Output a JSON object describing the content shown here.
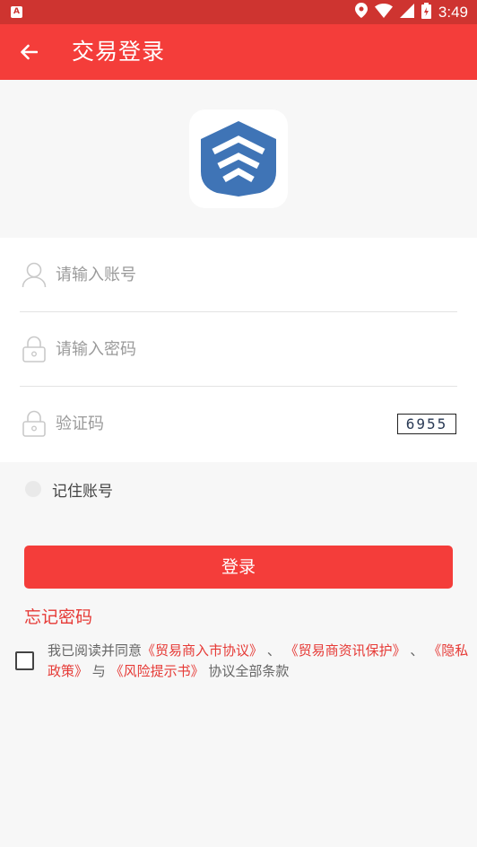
{
  "status_bar": {
    "time": "3:49",
    "notification_icon": "A"
  },
  "app_bar": {
    "title": "交易登录",
    "back_icon": "arrow-left-icon"
  },
  "form": {
    "account_placeholder": "请输入账号",
    "password_placeholder": "请输入密码",
    "captcha_placeholder": "验证码",
    "captcha_code": "6955"
  },
  "remember": {
    "label": "记住账号"
  },
  "login_button": "登录",
  "forgot_password": "忘记密码",
  "agreement": {
    "prefix": "我已阅读并同意",
    "link1": "《贸易商入市协议》",
    "sep1": "、",
    "link2": "《贸易商资讯保护》",
    "sep2": "、",
    "link3": "《隐私政策》",
    "conj": "与",
    "link4": "《风险提示书》",
    "suffix": "协议全部条款"
  },
  "colors": {
    "primary": "#f43d3a",
    "status_bar": "#ce3430",
    "logo_blue": "#3f74b6"
  }
}
